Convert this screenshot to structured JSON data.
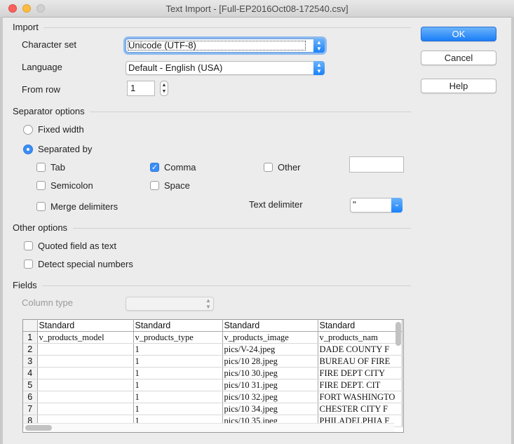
{
  "window": {
    "title": "Text Import - [Full-EP2016Oct08-172540.csv]"
  },
  "import": {
    "section_label": "Import",
    "character_set_label": "Character set",
    "character_set_value": "Unicode (UTF-8)",
    "language_label": "Language",
    "language_value": "Default - English (USA)",
    "from_row_label": "From row",
    "from_row_value": "1"
  },
  "separator": {
    "section_label": "Separator options",
    "fixed_width_label": "Fixed width",
    "separated_by_label": "Separated by",
    "tab_label": "Tab",
    "comma_label": "Comma",
    "other_label": "Other",
    "semicolon_label": "Semicolon",
    "space_label": "Space",
    "merge_delimiters_label": "Merge delimiters",
    "text_delimiter_label": "Text delimiter",
    "text_delimiter_value": "\"",
    "separated_by_selected": true,
    "comma_checked": true
  },
  "other_options": {
    "section_label": "Other options",
    "quoted_field_label": "Quoted field as text",
    "detect_special_label": "Detect special numbers"
  },
  "fields": {
    "section_label": "Fields",
    "column_type_label": "Column type",
    "column_type_value": "",
    "headers": [
      "Standard",
      "Standard",
      "Standard",
      "Standard"
    ],
    "rows": [
      {
        "n": "1",
        "cells": [
          "v_products_model",
          "v_products_type",
          "v_products_image",
          "v_products_nam"
        ]
      },
      {
        "n": "2",
        "cells": [
          "",
          "1",
          "pics/V-24.jpeg",
          "DADE COUNTY F"
        ]
      },
      {
        "n": "3",
        "cells": [
          "",
          "1",
          "pics/10  28.jpeg",
          "BUREAU OF FIRE"
        ]
      },
      {
        "n": "4",
        "cells": [
          "",
          "1",
          "pics/10  30.jpeg",
          "FIRE DEPT CITY"
        ]
      },
      {
        "n": "5",
        "cells": [
          "",
          "1",
          "pics/10  31.jpeg",
          "FIRE DEPT. CIT"
        ]
      },
      {
        "n": "6",
        "cells": [
          "",
          "1",
          "pics/10  32.jpeg",
          "FORT WASHINGTO"
        ]
      },
      {
        "n": "7",
        "cells": [
          "",
          "1",
          "pics/10  34.jpeg",
          "CHESTER CITY F"
        ]
      },
      {
        "n": "8",
        "cells": [
          "",
          "1",
          "pics/10  35.jpeg",
          "PHILADELPHIA F"
        ]
      }
    ]
  },
  "buttons": {
    "ok": "OK",
    "cancel": "Cancel",
    "help": "Help"
  },
  "colors": {
    "accent": "#1a82fb"
  }
}
